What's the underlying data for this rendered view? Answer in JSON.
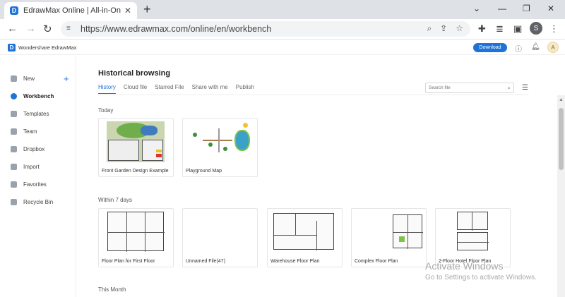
{
  "browser": {
    "tab_title": "EdrawMax Online | All-in-One Diagram",
    "url": "https://www.edrawmax.com/online/en/workbench",
    "profile_initial": "S"
  },
  "app": {
    "brand": "Wondershare EdrawMax",
    "download_label": "Download",
    "avatar_initial": "A"
  },
  "sidebar": {
    "items": [
      {
        "label": "New",
        "icon": "new-file-icon"
      },
      {
        "label": "Workbench",
        "icon": "cloud-icon",
        "active": true
      },
      {
        "label": "Templates",
        "icon": "templates-icon"
      },
      {
        "label": "Team",
        "icon": "team-icon"
      },
      {
        "label": "Dropbox",
        "icon": "dropbox-icon"
      },
      {
        "label": "Import",
        "icon": "import-icon"
      },
      {
        "label": "Favorites",
        "icon": "heart-icon"
      },
      {
        "label": "Recycle Bin",
        "icon": "trash-icon"
      }
    ]
  },
  "main": {
    "title": "Historical browsing",
    "tabs": [
      "History",
      "Cloud file",
      "Starred File",
      "Share with me",
      "Publish"
    ],
    "search_placeholder": "Search file",
    "sections": {
      "today": {
        "label": "Today",
        "files": [
          "Front Garden Design Example",
          "Playground Map"
        ]
      },
      "week": {
        "label": "Within 7 days",
        "files": [
          "Floor Plan for First Floor",
          "Unnamed File(47)",
          "Warehouse Floor Plan",
          "Complex Floor Plan",
          "2-Floor Hotel Floor Plan"
        ]
      },
      "month": {
        "label": "This Month"
      }
    }
  },
  "watermark": {
    "line1": "Activate Windows",
    "line2": "Go to Settings to activate Windows."
  },
  "colors": {
    "accent": "#1f72d6"
  }
}
